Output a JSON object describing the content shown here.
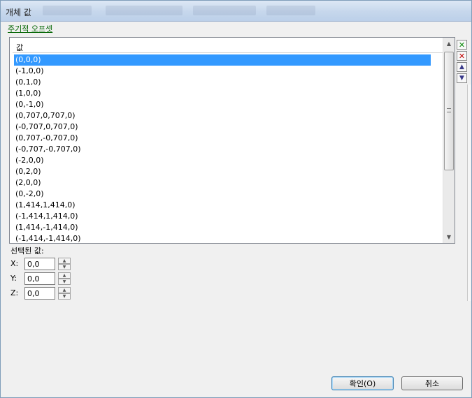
{
  "window": {
    "title": "개체 값"
  },
  "link": {
    "label": "주기적 오프셋"
  },
  "list": {
    "header": "값",
    "selected_index": 0,
    "rows": [
      "(0,0,0)",
      "(-1,0,0)",
      "(0,1,0)",
      "(1,0,0)",
      "(0,-1,0)",
      "(0,707,0,707,0)",
      "(-0,707,0,707,0)",
      "(0,707,-0,707,0)",
      "(-0,707,-0,707,0)",
      "(-2,0,0)",
      "(0,2,0)",
      "(2,0,0)",
      "(0,-2,0)",
      "(1,414,1,414,0)",
      "(-1,414,1,414,0)",
      "(1,414,-1,414,0)",
      "(-1,414,-1,414,0)"
    ]
  },
  "selected_values": {
    "label": "선택된 값:",
    "x": {
      "label": "X:",
      "value": "0,0"
    },
    "y": {
      "label": "Y:",
      "value": "0,0"
    },
    "z": {
      "label": "Z:",
      "value": "0,0"
    }
  },
  "buttons": {
    "ok": "확인(O)",
    "cancel": "취소"
  },
  "icons": {
    "add": "add-row-icon",
    "delete": "delete-row-icon",
    "up": "move-up-icon",
    "down": "move-down-icon"
  },
  "colors": {
    "selection": "#3399ff",
    "link": "#006400"
  }
}
